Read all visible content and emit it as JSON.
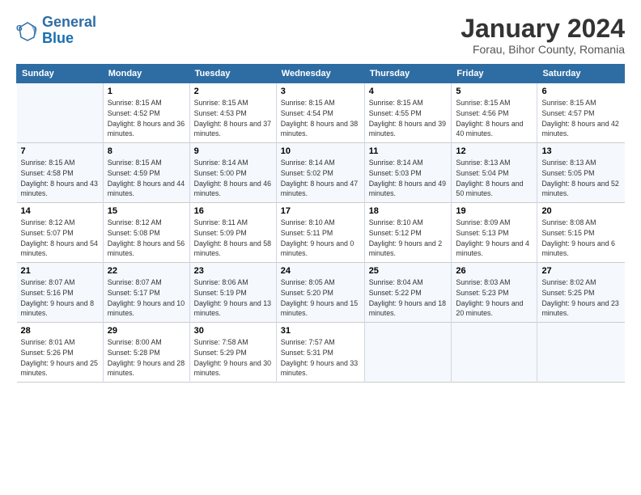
{
  "header": {
    "logo_line1": "General",
    "logo_line2": "Blue",
    "month": "January 2024",
    "location": "Forau, Bihor County, Romania"
  },
  "weekdays": [
    "Sunday",
    "Monday",
    "Tuesday",
    "Wednesday",
    "Thursday",
    "Friday",
    "Saturday"
  ],
  "weeks": [
    [
      {
        "day": "",
        "sunrise": "",
        "sunset": "",
        "daylight": ""
      },
      {
        "day": "1",
        "sunrise": "Sunrise: 8:15 AM",
        "sunset": "Sunset: 4:52 PM",
        "daylight": "Daylight: 8 hours and 36 minutes."
      },
      {
        "day": "2",
        "sunrise": "Sunrise: 8:15 AM",
        "sunset": "Sunset: 4:53 PM",
        "daylight": "Daylight: 8 hours and 37 minutes."
      },
      {
        "day": "3",
        "sunrise": "Sunrise: 8:15 AM",
        "sunset": "Sunset: 4:54 PM",
        "daylight": "Daylight: 8 hours and 38 minutes."
      },
      {
        "day": "4",
        "sunrise": "Sunrise: 8:15 AM",
        "sunset": "Sunset: 4:55 PM",
        "daylight": "Daylight: 8 hours and 39 minutes."
      },
      {
        "day": "5",
        "sunrise": "Sunrise: 8:15 AM",
        "sunset": "Sunset: 4:56 PM",
        "daylight": "Daylight: 8 hours and 40 minutes."
      },
      {
        "day": "6",
        "sunrise": "Sunrise: 8:15 AM",
        "sunset": "Sunset: 4:57 PM",
        "daylight": "Daylight: 8 hours and 42 minutes."
      }
    ],
    [
      {
        "day": "7",
        "sunrise": "Sunrise: 8:15 AM",
        "sunset": "Sunset: 4:58 PM",
        "daylight": "Daylight: 8 hours and 43 minutes."
      },
      {
        "day": "8",
        "sunrise": "Sunrise: 8:15 AM",
        "sunset": "Sunset: 4:59 PM",
        "daylight": "Daylight: 8 hours and 44 minutes."
      },
      {
        "day": "9",
        "sunrise": "Sunrise: 8:14 AM",
        "sunset": "Sunset: 5:00 PM",
        "daylight": "Daylight: 8 hours and 46 minutes."
      },
      {
        "day": "10",
        "sunrise": "Sunrise: 8:14 AM",
        "sunset": "Sunset: 5:02 PM",
        "daylight": "Daylight: 8 hours and 47 minutes."
      },
      {
        "day": "11",
        "sunrise": "Sunrise: 8:14 AM",
        "sunset": "Sunset: 5:03 PM",
        "daylight": "Daylight: 8 hours and 49 minutes."
      },
      {
        "day": "12",
        "sunrise": "Sunrise: 8:13 AM",
        "sunset": "Sunset: 5:04 PM",
        "daylight": "Daylight: 8 hours and 50 minutes."
      },
      {
        "day": "13",
        "sunrise": "Sunrise: 8:13 AM",
        "sunset": "Sunset: 5:05 PM",
        "daylight": "Daylight: 8 hours and 52 minutes."
      }
    ],
    [
      {
        "day": "14",
        "sunrise": "Sunrise: 8:12 AM",
        "sunset": "Sunset: 5:07 PM",
        "daylight": "Daylight: 8 hours and 54 minutes."
      },
      {
        "day": "15",
        "sunrise": "Sunrise: 8:12 AM",
        "sunset": "Sunset: 5:08 PM",
        "daylight": "Daylight: 8 hours and 56 minutes."
      },
      {
        "day": "16",
        "sunrise": "Sunrise: 8:11 AM",
        "sunset": "Sunset: 5:09 PM",
        "daylight": "Daylight: 8 hours and 58 minutes."
      },
      {
        "day": "17",
        "sunrise": "Sunrise: 8:10 AM",
        "sunset": "Sunset: 5:11 PM",
        "daylight": "Daylight: 9 hours and 0 minutes."
      },
      {
        "day": "18",
        "sunrise": "Sunrise: 8:10 AM",
        "sunset": "Sunset: 5:12 PM",
        "daylight": "Daylight: 9 hours and 2 minutes."
      },
      {
        "day": "19",
        "sunrise": "Sunrise: 8:09 AM",
        "sunset": "Sunset: 5:13 PM",
        "daylight": "Daylight: 9 hours and 4 minutes."
      },
      {
        "day": "20",
        "sunrise": "Sunrise: 8:08 AM",
        "sunset": "Sunset: 5:15 PM",
        "daylight": "Daylight: 9 hours and 6 minutes."
      }
    ],
    [
      {
        "day": "21",
        "sunrise": "Sunrise: 8:07 AM",
        "sunset": "Sunset: 5:16 PM",
        "daylight": "Daylight: 9 hours and 8 minutes."
      },
      {
        "day": "22",
        "sunrise": "Sunrise: 8:07 AM",
        "sunset": "Sunset: 5:17 PM",
        "daylight": "Daylight: 9 hours and 10 minutes."
      },
      {
        "day": "23",
        "sunrise": "Sunrise: 8:06 AM",
        "sunset": "Sunset: 5:19 PM",
        "daylight": "Daylight: 9 hours and 13 minutes."
      },
      {
        "day": "24",
        "sunrise": "Sunrise: 8:05 AM",
        "sunset": "Sunset: 5:20 PM",
        "daylight": "Daylight: 9 hours and 15 minutes."
      },
      {
        "day": "25",
        "sunrise": "Sunrise: 8:04 AM",
        "sunset": "Sunset: 5:22 PM",
        "daylight": "Daylight: 9 hours and 18 minutes."
      },
      {
        "day": "26",
        "sunrise": "Sunrise: 8:03 AM",
        "sunset": "Sunset: 5:23 PM",
        "daylight": "Daylight: 9 hours and 20 minutes."
      },
      {
        "day": "27",
        "sunrise": "Sunrise: 8:02 AM",
        "sunset": "Sunset: 5:25 PM",
        "daylight": "Daylight: 9 hours and 23 minutes."
      }
    ],
    [
      {
        "day": "28",
        "sunrise": "Sunrise: 8:01 AM",
        "sunset": "Sunset: 5:26 PM",
        "daylight": "Daylight: 9 hours and 25 minutes."
      },
      {
        "day": "29",
        "sunrise": "Sunrise: 8:00 AM",
        "sunset": "Sunset: 5:28 PM",
        "daylight": "Daylight: 9 hours and 28 minutes."
      },
      {
        "day": "30",
        "sunrise": "Sunrise: 7:58 AM",
        "sunset": "Sunset: 5:29 PM",
        "daylight": "Daylight: 9 hours and 30 minutes."
      },
      {
        "day": "31",
        "sunrise": "Sunrise: 7:57 AM",
        "sunset": "Sunset: 5:31 PM",
        "daylight": "Daylight: 9 hours and 33 minutes."
      },
      {
        "day": "",
        "sunrise": "",
        "sunset": "",
        "daylight": ""
      },
      {
        "day": "",
        "sunrise": "",
        "sunset": "",
        "daylight": ""
      },
      {
        "day": "",
        "sunrise": "",
        "sunset": "",
        "daylight": ""
      }
    ]
  ]
}
